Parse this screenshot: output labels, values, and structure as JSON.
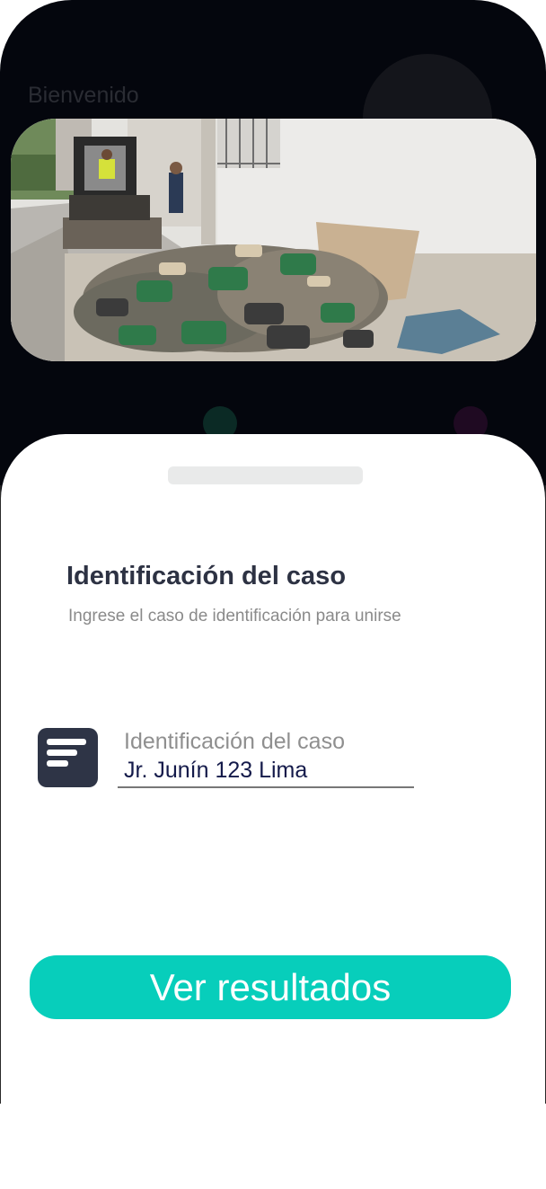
{
  "header": {
    "welcome": "Bienvenido"
  },
  "hero": {
    "alt": "Maquinaria retirando escombros y bolsas de cemento en una calle"
  },
  "form": {
    "title": "Identificación del caso",
    "subtitle": "Ingrese el caso de identificación para unirse",
    "field": {
      "label": "Identificación del caso",
      "value": "Jr. Junín 123 Lima"
    },
    "icon": "notes-icon",
    "submit_label": "Ver resultados"
  },
  "colors": {
    "background_dark": "#04060d",
    "accent": "#07cebb",
    "icon_bg": "#2e3446",
    "title": "#2d3243"
  }
}
